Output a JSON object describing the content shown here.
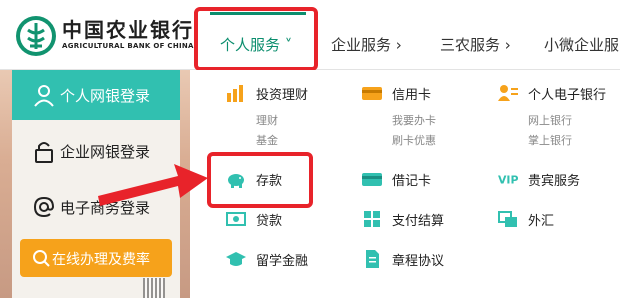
{
  "brand": {
    "name_cn": "中国农业银行",
    "name_en": "AGRICULTURAL BANK OF CHINA"
  },
  "nav": {
    "items": [
      {
        "label": "个人服务 ˅",
        "active": true
      },
      {
        "label": "企业服务 ›"
      },
      {
        "label": "三农服务 ›"
      },
      {
        "label": "小微企业服"
      }
    ]
  },
  "left_panel": {
    "items": [
      {
        "label": "个人网银登录",
        "icon": "person-icon"
      },
      {
        "label": "企业网银登录",
        "icon": "lock-icon"
      },
      {
        "label": "电子商务登录",
        "icon": "at-icon"
      }
    ],
    "cta": {
      "label": "在线办理及费率",
      "icon": "search-icon"
    }
  },
  "menu": {
    "col1": {
      "head": {
        "label": "投资理财",
        "icon": "chart-bar-icon"
      },
      "subs": [
        "理财",
        "基金"
      ],
      "items": [
        {
          "label": "存款",
          "icon": "piggy-bank-icon"
        },
        {
          "label": "贷款",
          "icon": "money-icon"
        },
        {
          "label": "留学金融",
          "icon": "graduation-cap-icon"
        }
      ]
    },
    "col2": {
      "head": {
        "label": "信用卡",
        "icon": "credit-card-icon"
      },
      "subs": [
        "我要办卡",
        "刷卡优惠"
      ],
      "items": [
        {
          "label": "借记卡",
          "icon": "debit-card-icon"
        },
        {
          "label": "支付结算",
          "icon": "settlement-icon"
        },
        {
          "label": "章程协议",
          "icon": "document-icon"
        }
      ]
    },
    "col3": {
      "head": {
        "label": "个人电子银行",
        "icon": "user-card-icon"
      },
      "subs": [
        "网上银行",
        "掌上银行"
      ],
      "items": [
        {
          "label": "贵宾服务",
          "icon": "vip-icon"
        },
        {
          "label": "外汇",
          "icon": "exchange-icon"
        }
      ]
    }
  },
  "colors": {
    "accent": "#0c8e6e",
    "highlight": "#e8232a",
    "orange": "#f6a21b",
    "teal": "#31c0b0"
  }
}
